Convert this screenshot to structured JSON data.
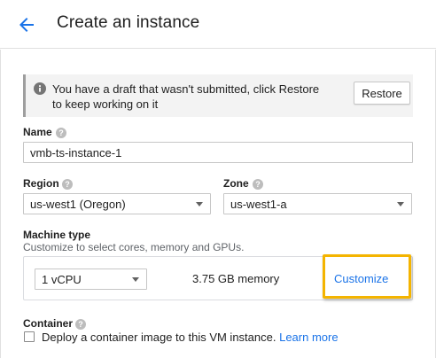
{
  "header": {
    "title": "Create an instance"
  },
  "banner": {
    "message": "You have a draft that wasn't submitted, click Restore to keep working on it",
    "restore_label": "Restore"
  },
  "name_field": {
    "label": "Name",
    "value": "vmb-ts-instance-1"
  },
  "region_field": {
    "label": "Region",
    "value": "us-west1 (Oregon)"
  },
  "zone_field": {
    "label": "Zone",
    "value": "us-west1-a"
  },
  "machine_type": {
    "label": "Machine type",
    "description": "Customize to select cores, memory and GPUs.",
    "cpu_value": "1 vCPU",
    "memory": "3.75 GB memory",
    "customize_label": "Customize"
  },
  "container": {
    "label": "Container",
    "checkbox_label": "Deploy a container image to this VM instance.",
    "learn_more": "Learn more",
    "checked": false
  },
  "colors": {
    "accent": "#1a73e8",
    "highlight": "#f4b400",
    "banner_bg": "#f3f3f3"
  }
}
